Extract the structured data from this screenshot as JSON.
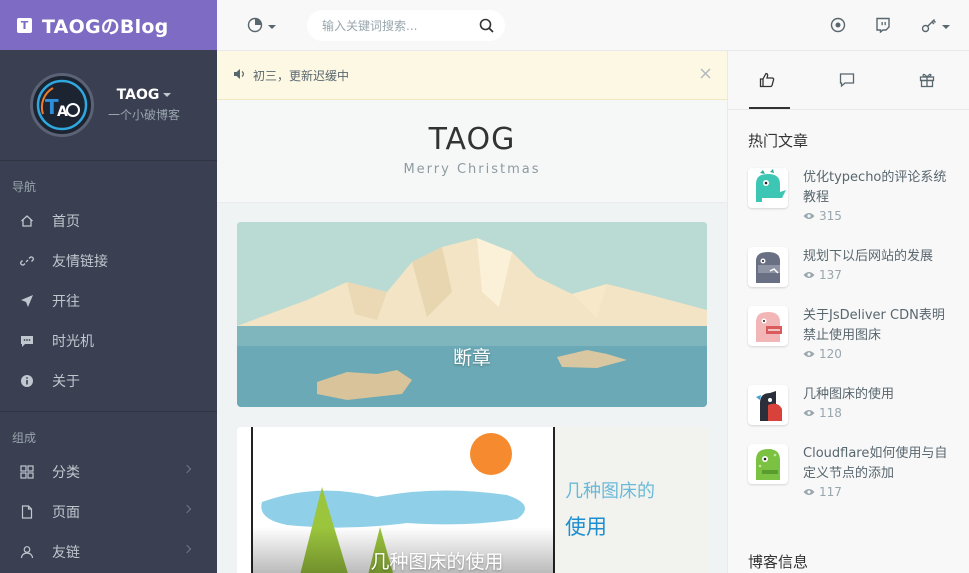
{
  "brand": {
    "logo_letter": "T",
    "title": "TAOGのBlog"
  },
  "profile": {
    "name": "TAOG",
    "subtitle": "一个小破博客"
  },
  "nav": {
    "section1": "导航",
    "items1": [
      {
        "label": "首页",
        "icon": "home-icon"
      },
      {
        "label": "友情链接",
        "icon": "link-icon"
      },
      {
        "label": "开往",
        "icon": "send-icon"
      },
      {
        "label": "时光机",
        "icon": "chat-bubble-icon"
      },
      {
        "label": "关于",
        "icon": "info-icon"
      }
    ],
    "section2": "组成",
    "items2": [
      {
        "label": "分类",
        "icon": "grid-icon"
      },
      {
        "label": "页面",
        "icon": "file-icon"
      },
      {
        "label": "友链",
        "icon": "user-icon"
      }
    ]
  },
  "header": {
    "search_placeholder": "输入关键词搜索..."
  },
  "notice": {
    "text": "初三，更新迟缓中"
  },
  "blog": {
    "title": "TAOG",
    "subtitle": "Merry Christmas"
  },
  "posts": [
    {
      "title": "断章"
    },
    {
      "title": "几种图床的使用",
      "image_text_line1": "几种图床的",
      "image_text_line2": "使用"
    }
  ],
  "aside": {
    "hot_title": "热门文章",
    "hot_posts": [
      {
        "title": "优化typecho的评论系统教程",
        "views": "315"
      },
      {
        "title": "规划下以后网站的发展",
        "views": "137"
      },
      {
        "title": "关于JsDeliver CDN表明禁止使用图床",
        "views": "120"
      },
      {
        "title": "几种图床的使用",
        "views": "118"
      },
      {
        "title": "Cloudflare如何使用与自定义节点的添加",
        "views": "117"
      }
    ],
    "blog_info_title": "博客信息"
  },
  "colors": {
    "brand": "#7e6bc4",
    "sidebar": "#3a3f51",
    "notice_bg": "#fcf8e3",
    "sun": "#f58b2e"
  }
}
